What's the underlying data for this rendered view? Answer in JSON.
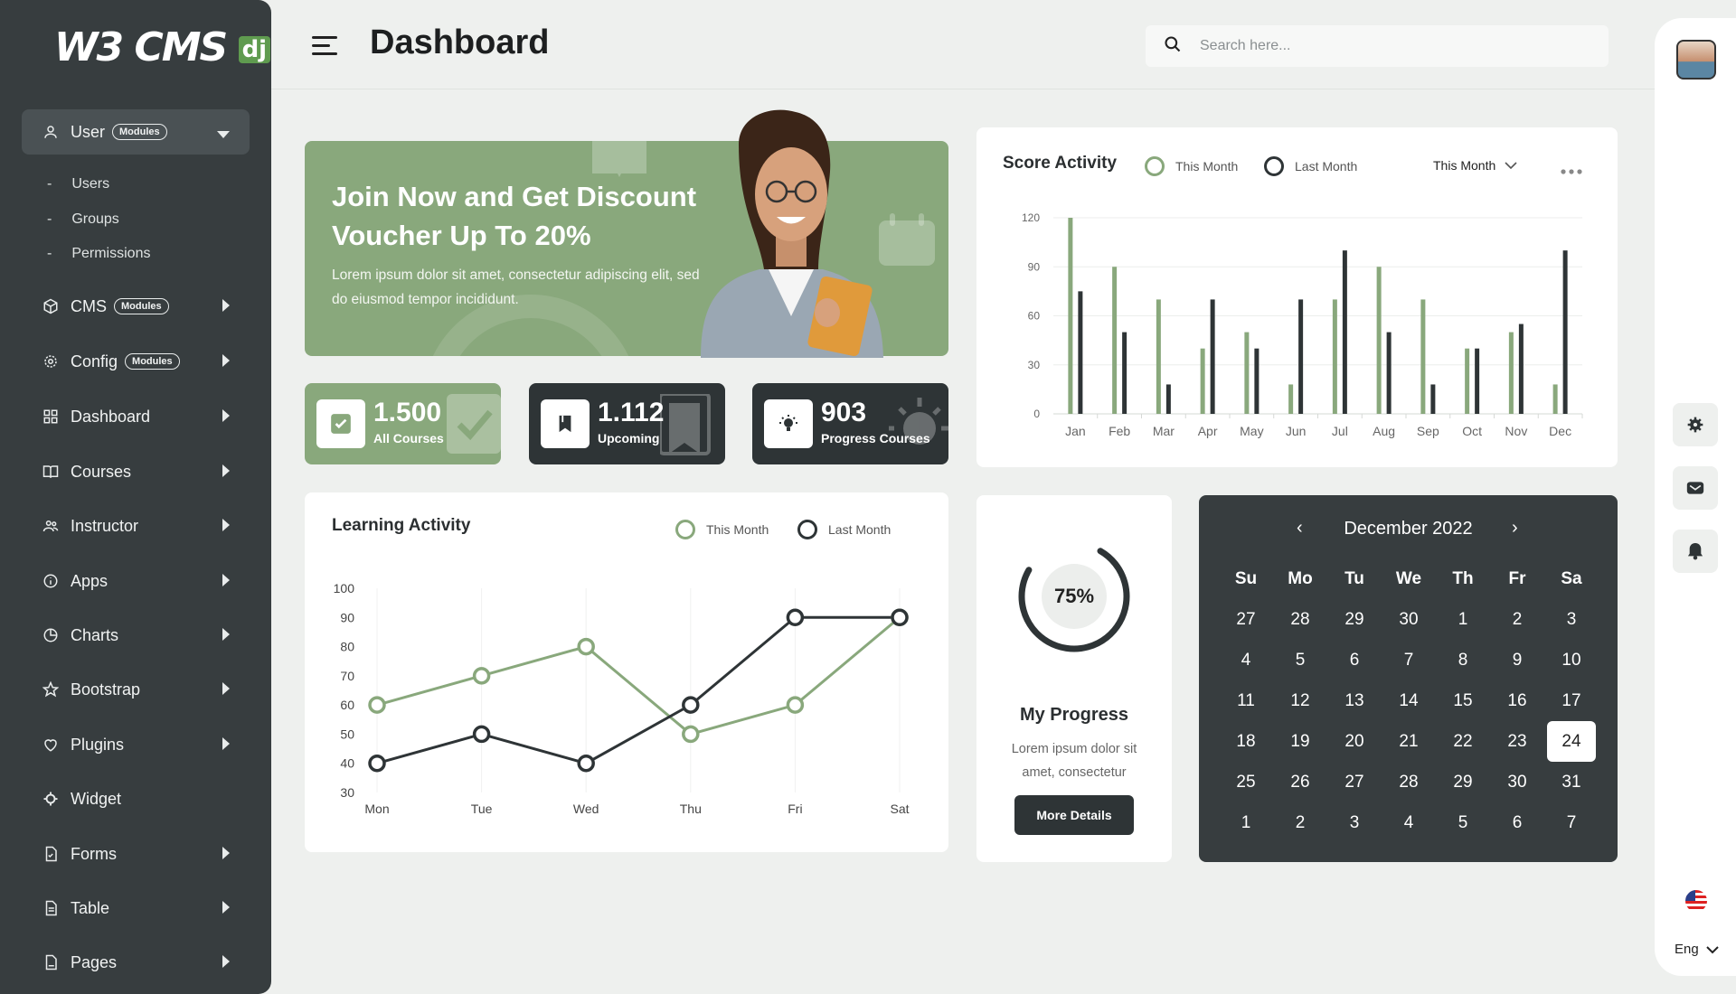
{
  "brand": {
    "logo_text": "W3 CMS",
    "logo_badge": "dj"
  },
  "sidebar": {
    "items": [
      {
        "label": "User",
        "badge": "Modules",
        "icon": "user-icon"
      },
      {
        "label": "CMS",
        "badge": "Modules",
        "icon": "cube-icon"
      },
      {
        "label": "Config",
        "badge": "Modules",
        "icon": "gear-icon"
      },
      {
        "label": "Dashboard",
        "icon": "grid-icon"
      },
      {
        "label": "Courses",
        "icon": "book-icon"
      },
      {
        "label": "Instructor",
        "icon": "users-icon"
      },
      {
        "label": "Apps",
        "icon": "info-icon"
      },
      {
        "label": "Charts",
        "icon": "pie-icon"
      },
      {
        "label": "Bootstrap",
        "icon": "star-icon"
      },
      {
        "label": "Plugins",
        "icon": "heart-icon"
      },
      {
        "label": "Widget",
        "icon": "settings-icon"
      },
      {
        "label": "Forms",
        "icon": "file-check-icon"
      },
      {
        "label": "Table",
        "icon": "file-text-icon"
      },
      {
        "label": "Pages",
        "icon": "file-icon"
      }
    ],
    "sub_items": [
      {
        "label": "Users"
      },
      {
        "label": "Groups"
      },
      {
        "label": "Permissions"
      }
    ]
  },
  "header": {
    "title": "Dashboard",
    "search_placeholder": "Search here..."
  },
  "promo": {
    "title": "Join Now and Get Discount Voucher Up To 20%",
    "text": "Lorem ipsum dolor sit amet, consectetur adipiscing elit, sed do eiusmod tempor incididunt."
  },
  "stats": [
    {
      "value": "1.500",
      "label": "All Courses",
      "color": "#89a87c"
    },
    {
      "value": "1.112",
      "label": "Upcoming",
      "color": "#2e3436"
    },
    {
      "value": "903",
      "label": "Progress Courses",
      "color": "#2e3436"
    }
  ],
  "score_activity": {
    "title": "Score Activity",
    "legend_this": "This Month",
    "legend_last": "Last Month",
    "dropdown": "This Month"
  },
  "learning_activity": {
    "title": "Learning Activity",
    "legend_this": "This Month",
    "legend_last": "Last Month"
  },
  "progress": {
    "value": 75,
    "label": "75%",
    "title": "My Progress",
    "text": "Lorem ipsum dolor sit amet, consectetur",
    "button": "More Details"
  },
  "calendar": {
    "title": "December 2022",
    "prev": "‹",
    "next": "›",
    "days": [
      "Su",
      "Mo",
      "Tu",
      "We",
      "Th",
      "Fr",
      "Sa"
    ],
    "dates": [
      27,
      28,
      29,
      30,
      1,
      2,
      3,
      4,
      5,
      6,
      7,
      8,
      9,
      10,
      11,
      12,
      13,
      14,
      15,
      16,
      17,
      18,
      19,
      20,
      21,
      22,
      23,
      24,
      25,
      26,
      27,
      28,
      29,
      30,
      31,
      1,
      2,
      3,
      4,
      5,
      6,
      7
    ],
    "selected": 24
  },
  "language": {
    "label": "Eng"
  },
  "colors": {
    "accent": "#89a87c",
    "dark": "#2e3436",
    "sidebar": "#373d3f"
  },
  "chart_data": [
    {
      "type": "bar",
      "title": "Score Activity",
      "categories": [
        "Jan",
        "Feb",
        "Mar",
        "Apr",
        "May",
        "Jun",
        "Jul",
        "Aug",
        "Sep",
        "Oct",
        "Nov",
        "Dec"
      ],
      "series": [
        {
          "name": "This Month",
          "values": [
            120,
            90,
            70,
            40,
            50,
            18,
            70,
            90,
            70,
            40,
            50,
            18
          ],
          "color": "#89a87c"
        },
        {
          "name": "Last Month",
          "values": [
            75,
            50,
            18,
            70,
            40,
            70,
            100,
            50,
            18,
            40,
            55,
            100
          ],
          "color": "#2e3436"
        }
      ],
      "ylim": [
        0,
        120
      ],
      "yticks": [
        0,
        30,
        60,
        90,
        120
      ],
      "grid": true
    },
    {
      "type": "line",
      "title": "Learning Activity",
      "categories": [
        "Mon",
        "Tue",
        "Wed",
        "Thu",
        "Fri",
        "Sat"
      ],
      "series": [
        {
          "name": "This Month",
          "values": [
            60,
            70,
            80,
            50,
            60,
            90
          ],
          "color": "#89a87c"
        },
        {
          "name": "Last Month",
          "values": [
            40,
            50,
            40,
            60,
            90,
            90
          ],
          "color": "#2e3436"
        }
      ],
      "ylim": [
        30,
        100
      ],
      "yticks": [
        30,
        40,
        50,
        60,
        70,
        80,
        90,
        100
      ],
      "grid": true
    }
  ]
}
